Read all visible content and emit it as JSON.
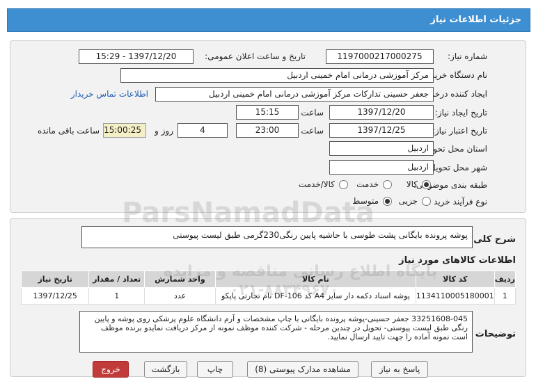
{
  "header": {
    "title": "جزئیات اطلاعات نیاز"
  },
  "form": {
    "need_number_label": "شماره نیاز:",
    "need_number": "1197000217000275",
    "announce_label": "تاریخ و ساعت اعلان عمومی:",
    "announce_value": "1397/12/20 - 15:29",
    "buyer_label": "نام دستگاه خریدار:",
    "buyer_value": "مرکز آموزشی درمانی امام خمینی اردبیل",
    "requester_label": "ایجاد کننده درخواست:",
    "requester_value": "جعفر حسینی تدارکات  مرکز آموزشی درمانی امام خمینی اردبیل",
    "contact_link": "اطلاعات تماس خریدار",
    "created_label": "تاریخ ایجاد نیاز:",
    "created_date": "1397/12/20",
    "time_label": "ساعت",
    "created_time": "15:15",
    "validity_label": "تاریخ اعتبار نیاز:",
    "validity_date": "1397/12/25",
    "validity_time": "23:00",
    "days_value": "4",
    "days_label": "روز و",
    "remaining_time": "15:00:25",
    "remaining_label": "ساعت باقی مانده",
    "province_label": "استان محل تحویل:",
    "province_value": "اردبیل",
    "city_label": "شهر محل تحویل:",
    "city_value": "اردبیل",
    "category_label": "طبقه بندی موضوعی:",
    "category_options": [
      "کالا",
      "خدمت",
      "کالا/خدمت"
    ],
    "process_label": "نوع فرآیند خرید :",
    "process_options": [
      "جزیی",
      "متوسط"
    ]
  },
  "summary": {
    "label": "شرح کلی نیاز:",
    "text": "پوشه پرونده بایگانی پشت طوسی با حاشیه پایین رنگی230گرمی طبق لیست پیوستی"
  },
  "goods": {
    "title": "اطلاعات کالاهای مورد نیاز",
    "columns": [
      "ردیف",
      "کد کالا",
      "نام کالا",
      "واحد شمارش",
      "تعداد / مقدار",
      "تاریخ نیاز"
    ],
    "rows": [
      [
        "1",
        "1134110005180001",
        "پوشه اسناد دکمه دار سایز A4 کد DF-106 نام تجارتی پاپکو",
        "عدد",
        "1",
        "1397/12/25"
      ]
    ]
  },
  "notes": {
    "label": "توضیحات خریدار:",
    "text": "33251608-045 جعفر حسینی-پوشه پرونده بایگانی با چاپ مشخصات و آرم دانشگاه علوم پزشکی روی پوشه و پایین رنگی طبق لیست پیوستی- تحویل در چندین مرحله - شرکت کننده موظف نمونه از مرکز دریافت نمایدو برنده موظف است  نمونه آماده را جهت تایید ارسال نمایید."
  },
  "watermark": {
    "line1": "ParsNamadData",
    "line2": "پایگاه اطلاع رسانی مناقصه و مزایده",
    "line3": "۰۲۱-۸۸۳۴۹۶۷۰"
  },
  "buttons": {
    "reply": "پاسخ به نیاز",
    "view_docs": "مشاهده مدارک پیوستی (8)",
    "print": "چاپ",
    "back": "بازگشت",
    "exit": "خروج"
  }
}
